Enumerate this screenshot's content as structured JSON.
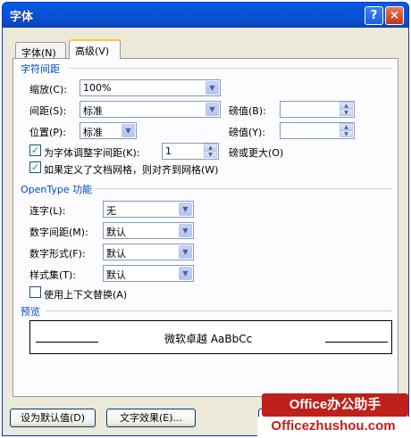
{
  "window": {
    "title": "字体",
    "help_label": "?",
    "close_label": "×"
  },
  "tabs": [
    {
      "label": "字体(N)"
    },
    {
      "label": "高级(V)"
    }
  ],
  "char_spacing": {
    "section_title": "字符间距",
    "scale_label": "缩放(C):",
    "scale_value": "100%",
    "spacing_label": "间距(S):",
    "spacing_value": "标准",
    "spacing_pt_label": "磅值(B):",
    "spacing_pt_value": "",
    "position_label": "位置(P):",
    "position_value": "标准",
    "position_pt_label": "磅值(Y):",
    "position_pt_value": "",
    "kerning_label": "为字体调整字间距(K):",
    "kerning_checked": true,
    "kerning_value": "1",
    "kerning_suffix": "磅或更大(O)",
    "grid_label": "如果定义了文档网格，则对齐到网格(W)",
    "grid_checked": true
  },
  "opentype": {
    "section_title": "OpenType 功能",
    "ligatures_label": "连字(L):",
    "ligatures_value": "无",
    "num_spacing_label": "数字间距(M):",
    "num_spacing_value": "默认",
    "num_forms_label": "数字形式(F):",
    "num_forms_value": "默认",
    "stylistic_label": "样式集(T):",
    "stylistic_value": "默认",
    "contextual_label": "使用上下文替换(A)",
    "contextual_checked": false
  },
  "preview": {
    "section_title": "预览",
    "text": "微软卓越 AaBbCc"
  },
  "footer": {
    "default_button": "设为默认值(D)",
    "effects_button": "文字效果(E)..."
  },
  "watermark": {
    "brand": "Office办公助手",
    "site": "Officezhushou.com"
  },
  "colors": {
    "title_bar": "#0a5ee6",
    "section_title": "#0046d5",
    "watermark": "#c0201a"
  }
}
